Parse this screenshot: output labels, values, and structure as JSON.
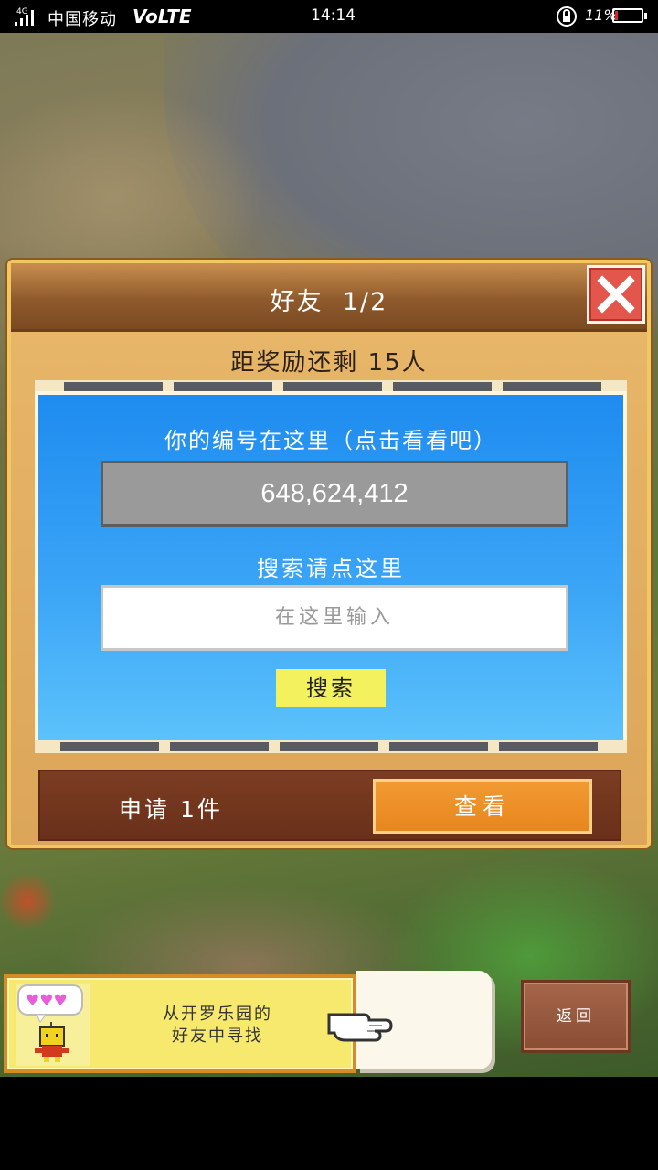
{
  "status_bar": {
    "network": "4G",
    "carrier": "中国移动",
    "volte": "VoLTE",
    "time": "14:14",
    "battery_percent": "11%",
    "battery_level": 0.11,
    "battery_color": "#e32424"
  },
  "dialog": {
    "title": "好友  1/2",
    "close_icon": "close-x-icon",
    "reward_text": "距奖励还剩 15人",
    "id_label": "你的编号在这里（点击看看吧）",
    "id_value": "648,624,412",
    "search_label": "搜索请点这里",
    "search_placeholder": "在这里输入",
    "search_button": "搜索",
    "request_label": "申请 1件",
    "view_button": "查看"
  },
  "banner": {
    "text_line1": "从开罗乐园的",
    "text_line2": "好友中寻找"
  },
  "back_button": "返回",
  "colors": {
    "panel_blue": "#1e8cf0",
    "accent_orange": "#e8861f",
    "arrow_green": "#c8e02a",
    "close_red": "#e2564c"
  }
}
